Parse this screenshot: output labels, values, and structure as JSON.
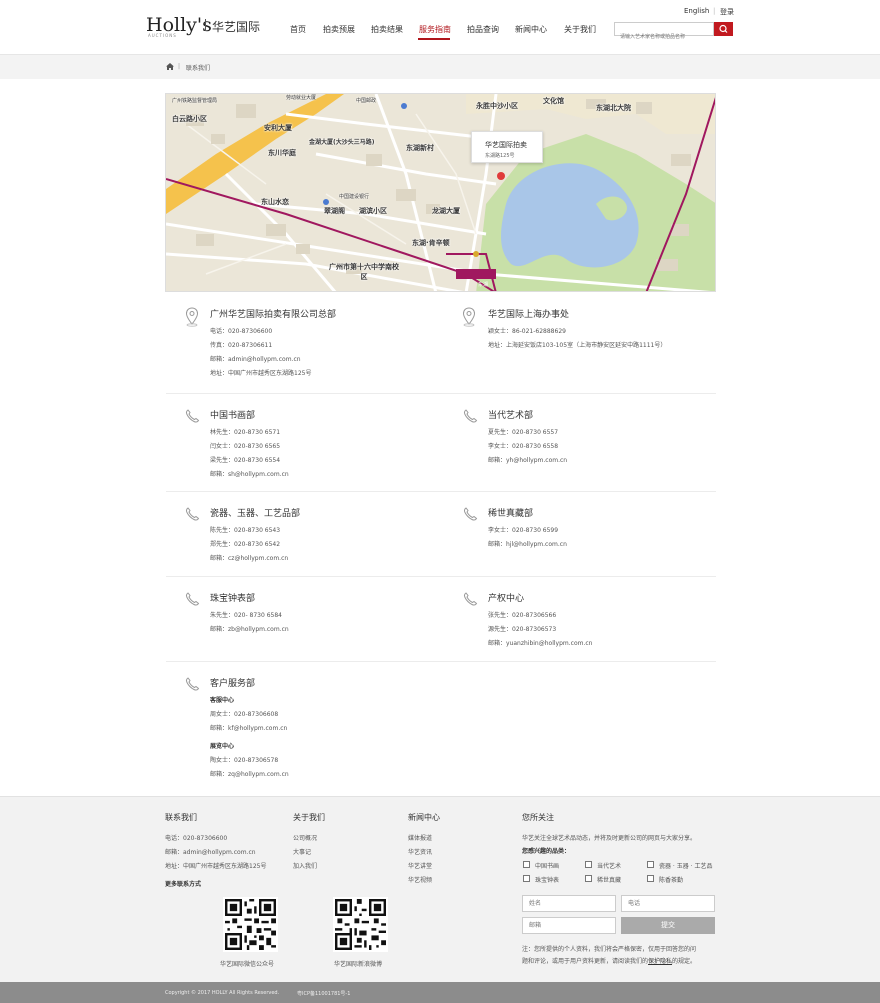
{
  "header": {
    "logo_text": "Holly's",
    "logo_sub": "AUCTIONS",
    "logo_cn": "华艺国际",
    "nav": [
      "首页",
      "拍卖预展",
      "拍卖结果",
      "服务指南",
      "拍品查询",
      "新闻中心",
      "关于我们"
    ],
    "active_nav_index": 3,
    "lang": "English",
    "login": "登录",
    "search_placeholder": "请输入艺术家名称或拍品名称"
  },
  "breadcrumb": {
    "current": "联系我们"
  },
  "map": {
    "popup_title": "华艺国际拍卖",
    "popup_addr": "东湖路125号",
    "labels": [
      "广州铁路监督管理局",
      "白云路小区",
      "劳动就业大厦",
      "中国邮政",
      "永胜中沙小区",
      "文化馆",
      "东湖北大院",
      "安利大厦",
      "金湖大厦(大沙头三马路)",
      "东川华庭",
      "东湖新村",
      "东山水恋",
      "翠湖阁",
      "湖滨小区",
      "龙湖大厦",
      "东湖·肯辛顿",
      "广州市第十六中学南校区",
      "中国建设银行",
      "东湖"
    ]
  },
  "offices": [
    {
      "title": "广州华艺国际拍卖有限公司总部",
      "lines": [
        "电话：020-87306600",
        "传真：020-87306611",
        "邮箱：admin@hollypm.com.cn",
        "地址：中国广州市越秀区东湖路125号"
      ]
    },
    {
      "title": "华艺国际上海办事处",
      "lines": [
        "颖女士：86-021-62888629",
        "地址：上海延安饭店103-105室（上海市静安区延安中路1111号）"
      ]
    }
  ],
  "departments": [
    {
      "title": "中国书画部",
      "lines": [
        "林先生：020-8730 6571",
        "闫女士：020-8730 6565",
        "梁先生：020-8730 6554",
        "邮箱：sh@hollypm.com.cn"
      ]
    },
    {
      "title": "当代艺术部",
      "lines": [
        "夏先生：020-8730 6557",
        "李女士：020-8730 6558",
        "邮箱：yh@hollypm.com.cn"
      ]
    },
    {
      "title": "瓷器、玉器、工艺品部",
      "lines": [
        "陈先生：020-8730 6543",
        "郑先生：020-8730 6542",
        "邮箱：cz@hollypm.com.cn"
      ]
    },
    {
      "title": "稀世真藏部",
      "lines": [
        "李女士：020-8730 6599",
        "邮箱：hjl@hollypm.com.cn"
      ]
    },
    {
      "title": "珠宝钟表部",
      "lines": [
        "朱先生：020- 8730 6584",
        "邮箱：zb@hollypm.com.cn"
      ]
    },
    {
      "title": "产权中心",
      "lines": [
        "张先生：020-87306566",
        "源先生：020-87306573",
        "邮箱：yuanzhibin@hollypm.com.cn"
      ]
    }
  ],
  "service": {
    "title": "客户服务部",
    "sub1": "客服中心",
    "lines1": [
      "周女士：020-87306608",
      "邮箱：kf@hollypm.com.cn"
    ],
    "sub2": "展览中心",
    "lines2": [
      "陶女士：020-87306578",
      "邮箱：zq@hollypm.com.cn"
    ]
  },
  "footer": {
    "contact_h": "联系我们",
    "contact": [
      "电话：020-87306600",
      "邮箱：admin@hollypm.com.cn",
      "地址：中国广州市越秀区东湖路125号"
    ],
    "more": "更多联系方式",
    "qr1": "华艺国际微信公众号",
    "qr2": "华艺国际新浪微博",
    "about_h": "关于我们",
    "about": [
      "公司概况",
      "大事记",
      "加入我们"
    ],
    "news_h": "新闻中心",
    "news": [
      "媒体报道",
      "华艺资讯",
      "华艺讲堂",
      "华艺视频"
    ],
    "follow_h": "您所关注",
    "follow_desc": "华艺关注全球艺术品动态，并将及时更新公司的网页与大家分享。",
    "interest": "您感兴趣的品类：",
    "cats": [
      "中国书画",
      "当代艺术",
      "瓷器 · 玉器 · 工艺品",
      "珠宝钟表",
      "稀世真藏",
      "陈香茶勤"
    ],
    "name_ph": "姓名",
    "phone_ph": "电话",
    "email_ph": "邮箱",
    "submit": "提交",
    "note1": "注：您所提供的个人资料，我们将会严格保密，仅用于回答您的问",
    "note2": "题和评论，或用于用户资料更新，请阅读我们的",
    "privacy": "保护隐私",
    "note3": "的规定。"
  },
  "bottom": {
    "copyright": "Copyright © 2017 HOLLY All Rights Reserved.",
    "icp": "粤ICP备11001781号-1"
  }
}
